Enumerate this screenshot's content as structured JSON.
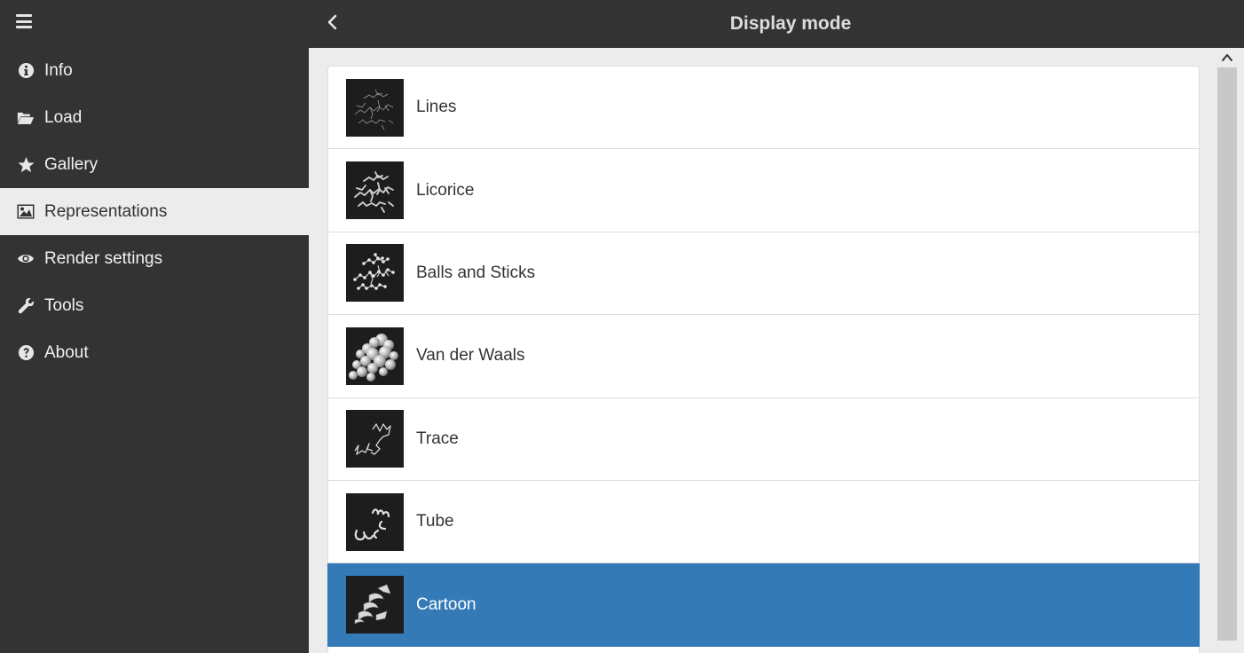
{
  "header": {
    "title": "Display mode"
  },
  "sidebar": {
    "items": [
      {
        "label": "Info",
        "icon": "info-circle-icon"
      },
      {
        "label": "Load",
        "icon": "folder-open-icon"
      },
      {
        "label": "Gallery",
        "icon": "star-icon"
      },
      {
        "label": "Representations",
        "icon": "picture-icon",
        "active": true
      },
      {
        "label": "Render settings",
        "icon": "eye-icon"
      },
      {
        "label": "Tools",
        "icon": "wrench-icon"
      },
      {
        "label": "About",
        "icon": "question-circle-icon"
      }
    ]
  },
  "display_modes": [
    {
      "label": "Lines"
    },
    {
      "label": "Licorice"
    },
    {
      "label": "Balls and Sticks"
    },
    {
      "label": "Van der Waals"
    },
    {
      "label": "Trace"
    },
    {
      "label": "Tube"
    },
    {
      "label": "Cartoon",
      "selected": true
    }
  ],
  "colors": {
    "sidebar_bg": "#333333",
    "active_item_bg": "#ececec",
    "selected_row_bg": "#337ab7",
    "content_bg": "#ececec"
  }
}
